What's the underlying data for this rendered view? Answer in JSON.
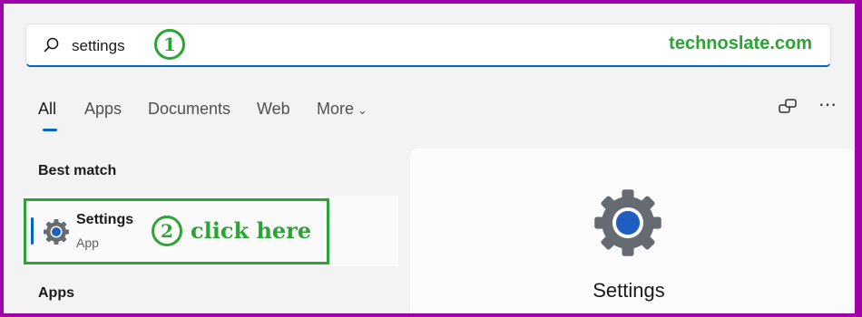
{
  "search": {
    "query": "settings",
    "step_marker": "1"
  },
  "watermark": "technoslate.com",
  "tabs": [
    {
      "label": "All"
    },
    {
      "label": "Apps"
    },
    {
      "label": "Documents"
    },
    {
      "label": "Web"
    },
    {
      "label": "More"
    }
  ],
  "icons": [
    "search-icon",
    "share-screen-icon",
    "more-options-icon",
    "settings-gear-icon",
    "chevron-down-icon"
  ],
  "sections": {
    "best_match": "Best match",
    "apps": "Apps"
  },
  "best_match": {
    "name": "Settings",
    "type": "App"
  },
  "annotation": {
    "step_marker": "2",
    "text": "click here"
  },
  "preview": {
    "name": "Settings"
  },
  "colors": {
    "accent": "#0067c0",
    "annotation_green": "#2aa534",
    "border_purple": "#a000a8"
  }
}
